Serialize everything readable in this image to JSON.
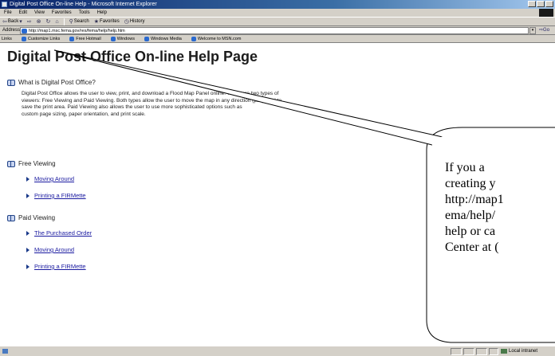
{
  "window": {
    "title": "Digital Post Office On-line Help - Microsoft Internet Explorer"
  },
  "menu": [
    "File",
    "Edit",
    "View",
    "Favorites",
    "Tools",
    "Help"
  ],
  "toolbar": {
    "back": "Back",
    "search": "Search",
    "favorites": "Favorites",
    "history": "History"
  },
  "address": {
    "label": "Address",
    "url": "http://map1.msc.fema.gov/res/fema/help/help.htm",
    "go": "Go"
  },
  "links": {
    "label": "Links",
    "items": [
      "Customize Links",
      "Free Hotmail",
      "Windows",
      "Windows Media",
      "Welcome to MSN.com"
    ]
  },
  "page": {
    "title": "Digital Post Office On-line Help Page",
    "sections": [
      {
        "heading": "What is Digital Post Office?",
        "description": [
          "Digital Post Office allows the user to view, print, and download a Flood Map Panel online. There are two types of",
          "viewers: Free Viewing and Paid Viewing. Both types allow the user to move the map in any direction (pan), and to",
          "save the print area. Paid Viewing also allows the user to use more sophisticated options such as",
          "custom page sizing, paper orientation, and print scale."
        ]
      },
      {
        "heading": "Free Viewing",
        "links": [
          "Moving Around",
          "Printing a FIRMette"
        ]
      },
      {
        "heading": "Paid Viewing",
        "links": [
          "The Purchased Order",
          "Moving Around",
          "Printing a FIRMette"
        ]
      }
    ]
  },
  "status": {
    "zone": "Local intranet"
  },
  "callout": {
    "lines": [
      "If you a",
      "creating y",
      "http://map1",
      "ema/help/",
      "help or ca",
      "Center at ("
    ]
  }
}
